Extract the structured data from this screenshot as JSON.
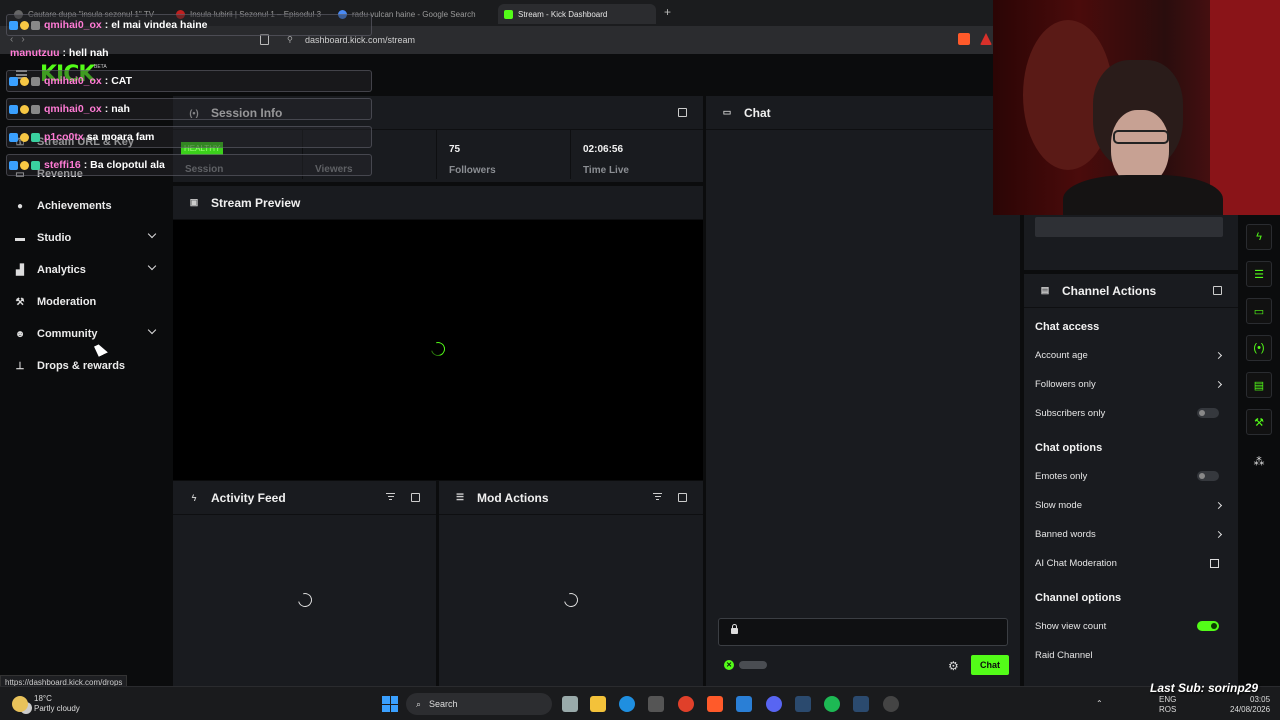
{
  "browser": {
    "tabs": [
      {
        "label": "Cautare dupa \"insula sezonul 1\" TV"
      },
      {
        "label": "Insula Iubirii | Sezonul 1 – Episodul 3"
      },
      {
        "label": "radu vulcan haine - Google Search"
      },
      {
        "label": "Stream - Kick Dashboard",
        "close": "✕"
      }
    ],
    "new_tab": "+",
    "url": "dashboard.kick.com/stream",
    "status_url": "https://dashboard.kick.com/drops"
  },
  "kick": {
    "logo": "KICK",
    "beta": "BETA"
  },
  "sidebar": {
    "items": [
      {
        "label": "Stream URL & Key"
      },
      {
        "label": "Revenue"
      },
      {
        "label": "Achievements"
      },
      {
        "label": "Studio"
      },
      {
        "label": "Analytics"
      },
      {
        "label": "Moderation"
      },
      {
        "label": "Community"
      },
      {
        "label": "Drops & rewards"
      }
    ]
  },
  "session": {
    "title": "Session Info",
    "health": "HEALTHY",
    "stats": [
      {
        "value": "",
        "label": "Session"
      },
      {
        "value": "",
        "label": "Viewers"
      },
      {
        "value": "75",
        "label": "Followers"
      },
      {
        "value": "02:06:56",
        "label": "Time Live"
      }
    ]
  },
  "preview": {
    "title": "Stream Preview"
  },
  "activity": {
    "title": "Activity Feed"
  },
  "mod_actions": {
    "title": "Mod Actions"
  },
  "chat": {
    "title": "Chat",
    "send_label": "Chat"
  },
  "channel_actions": {
    "title": "Channel Actions",
    "chat_access_title": "Chat access",
    "account_age": "Account age",
    "followers_only": "Followers only",
    "subscribers_only": "Subscribers only",
    "subscribers_only_on": false,
    "chat_options_title": "Chat options",
    "emotes_only": "Emotes only",
    "emotes_only_on": false,
    "slow_mode": "Slow mode",
    "banned_words": "Banned words",
    "ai_moderation": "AI Chat Moderation",
    "channel_options_title": "Channel options",
    "show_view_count": "Show view count",
    "show_view_count_on": true,
    "raid_channel": "Raid Channel"
  },
  "chat_overlay": [
    {
      "user": "qmihai0_ox",
      "user_color": "#ff7bd5",
      "message": ": el mai vindea haine",
      "boxed": true
    },
    {
      "user": "manutzuu",
      "user_color": "#ff7bd5",
      "message": ": hell nah",
      "boxed": false
    },
    {
      "user": "qmihai0_ox",
      "user_color": "#ff7bd5",
      "message": ": CAT",
      "boxed": true
    },
    {
      "user": "qmihai0_ox",
      "user_color": "#ff7bd5",
      "message": ": nah",
      "boxed": true
    },
    {
      "user": "p1co0tx",
      "user_color": "#ff7bd5",
      "message": " sa moara fam",
      "boxed": true
    },
    {
      "user": "steffi16",
      "user_color": "#ff7bd5",
      "message": ": Ba clopotul ala",
      "boxed": true
    }
  ],
  "taskbar": {
    "temp": "18°C",
    "weather": "Partly cloudy",
    "search": "Search",
    "lang1": "ENG",
    "lang2": "ROS",
    "time": "03:05",
    "date": "24/08/2026"
  },
  "overlay_lastsub": "Last Sub: sorinp29",
  "colors": {
    "accent": "#53fc18",
    "panel": "#191b1f",
    "bg": "#0b0c0d"
  }
}
